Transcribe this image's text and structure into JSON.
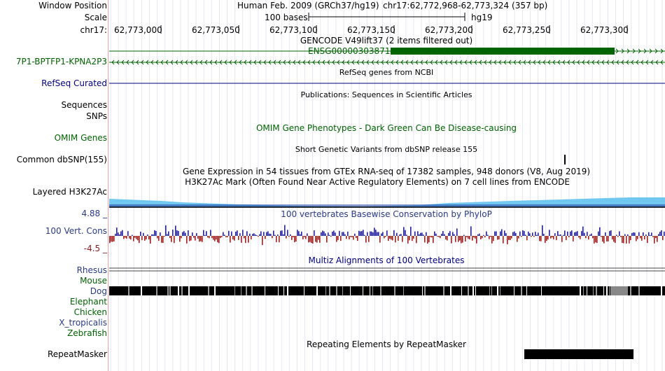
{
  "colors": {
    "gencode_green": "#006400",
    "refseq_blue": "#000080",
    "h3k27ac_blue": "#70c8f0",
    "phylop_pos": "#2020a0",
    "phylop_neg": "#a02020",
    "grid": "#e6e6f0"
  },
  "header": {
    "window_position_label": "Window Position",
    "scale_label": "Scale",
    "chrom_label": "chr17:",
    "assembly": "Human Feb. 2009 (GRCh37/hg19)",
    "position": "chr17:62,772,968-62,773,324 (357 bp)",
    "scale_text": "100 bases",
    "scale_db": "hg19",
    "ticks": [
      "62,773,000",
      "62,773,050",
      "62,773,100",
      "62,773,150",
      "62,773,200",
      "62,773,250",
      "62,773,300"
    ]
  },
  "tracks": {
    "gencode_title": "GENCODE V49lift37 (2 items filtered out)",
    "gencode_item": "ENSG00000303871",
    "gencode_label": "7P1-BPTFP1-KPNA2P3",
    "refseq_title": "RefSeq genes from NCBI",
    "refseq_label": "RefSeq Curated",
    "publications_title": "Publications: Sequences in Scientific Articles",
    "sequences_label": "Sequences",
    "snps_label": "SNPs",
    "omim_title": "OMIM Gene Phenotypes - Dark Green Can Be Disease-causing",
    "omim_label": "OMIM Genes",
    "dbsnp_title": "Short Genetic Variants from dbSNP release 155",
    "dbsnp_label": "Common dbSNP(155)",
    "gtex_title": "Gene Expression in 54 tissues from GTEx RNA-seq of 17382 samples, 948 donors (V8, Aug 2019)",
    "h3k27ac_title": "H3K27Ac Mark (Often Found Near Active Regulatory Elements) on 7 cell lines from ENCODE",
    "h3k27ac_label": "Layered H3K27Ac",
    "cons_title": "100 vertebrates Basewise Conservation by PhyloP",
    "cons_label": "100 Vert. Cons",
    "cons_max": "4.88 _",
    "cons_min": "-4.5 _",
    "multiz_title": "Multiz Alignments of 100 Vertebrates",
    "species": [
      "Rhesus",
      "Mouse",
      "Dog",
      "Elephant",
      "Chicken",
      "X_tropicalis",
      "Zebrafish"
    ],
    "repeat_title": "Repeating Elements by RepeatMasker",
    "repeat_label": "RepeatMasker"
  }
}
